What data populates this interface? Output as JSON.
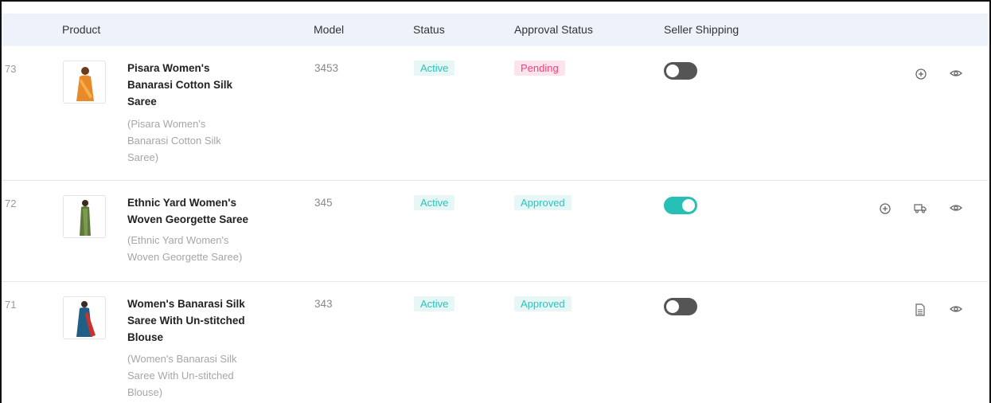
{
  "table": {
    "headers": {
      "product": "Product",
      "model": "Model",
      "status": "Status",
      "approval": "Approval Status",
      "shipping": "Seller Shipping"
    },
    "rows": [
      {
        "id": "73",
        "name_lines": [
          "Pisara Women's",
          "Banarasi Cotton Silk",
          "Saree"
        ],
        "sub_lines": [
          "(Pisara Women's",
          "Banarasi Cotton Silk",
          "Saree)"
        ],
        "model": "3453",
        "status": "Active",
        "approval": "Pending",
        "shipping_enabled": false,
        "actions": [
          "add-circle-icon",
          "eye-icon"
        ]
      },
      {
        "id": "72",
        "name_lines": [
          "Ethnic Yard Women's",
          "Woven Georgette Saree"
        ],
        "sub_lines": [
          "(Ethnic Yard Women's",
          "Woven Georgette Saree)"
        ],
        "model": "345",
        "status": "Active",
        "approval": "Approved",
        "shipping_enabled": true,
        "actions": [
          "add-circle-icon",
          "truck-icon",
          "eye-icon"
        ]
      },
      {
        "id": "71",
        "name_lines": [
          "Women's Banarasi Silk",
          "Saree With Un-stitched",
          "Blouse"
        ],
        "sub_lines": [
          "(Women's Banarasi Silk",
          "Saree With Un-stitched",
          "Blouse)"
        ],
        "model": "343",
        "status": "Active",
        "approval": "Approved",
        "shipping_enabled": false,
        "actions": [
          "document-icon",
          "eye-icon"
        ]
      }
    ]
  },
  "colors": {
    "accent": "#26c0b6",
    "pending": "#f0407e",
    "header_bg": "#eef3fb",
    "toggle_off": "#555555"
  }
}
